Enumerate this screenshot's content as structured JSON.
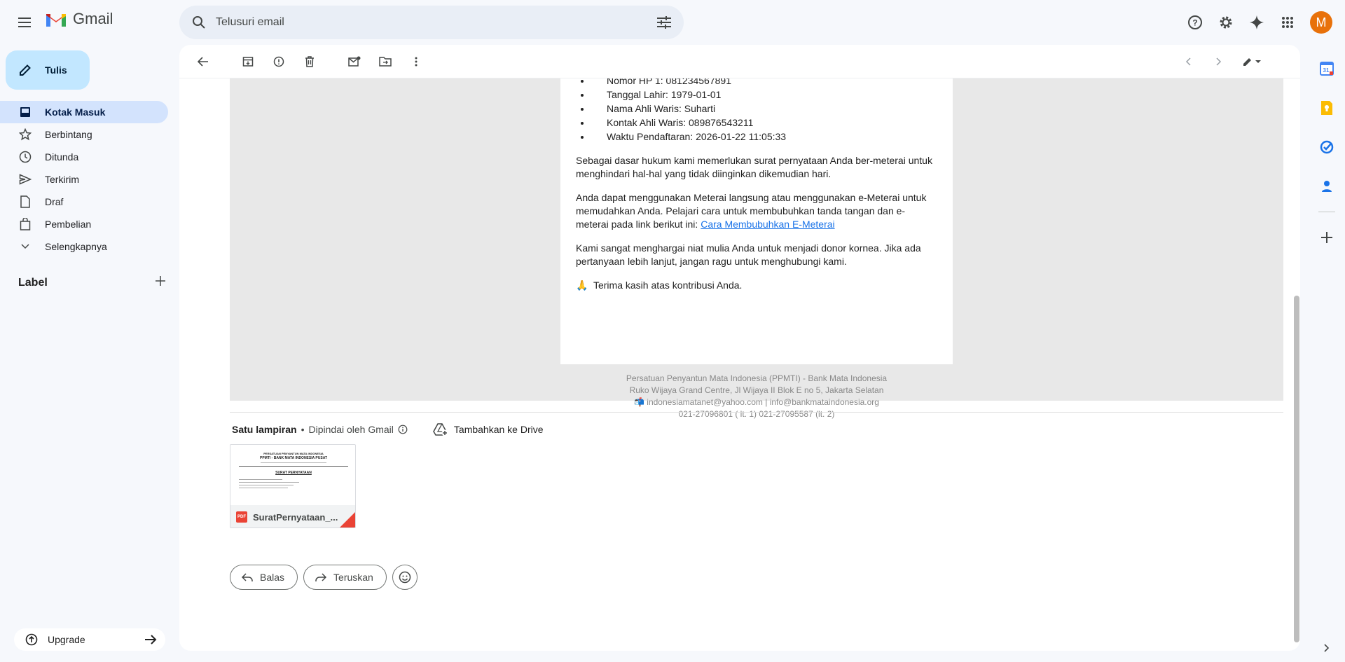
{
  "app": {
    "name": "Gmail"
  },
  "search": {
    "placeholder": "Telusuri email"
  },
  "avatar": {
    "initial": "M",
    "color": "#e8710a"
  },
  "compose": {
    "label": "Tulis"
  },
  "nav": {
    "items": [
      {
        "label": "Kotak Masuk",
        "icon": "inbox-icon",
        "active": true
      },
      {
        "label": "Berbintang",
        "icon": "star-icon"
      },
      {
        "label": "Ditunda",
        "icon": "clock-icon"
      },
      {
        "label": "Terkirim",
        "icon": "send-icon"
      },
      {
        "label": "Draf",
        "icon": "draft-icon"
      },
      {
        "label": "Pembelian",
        "icon": "shopping-bag-icon"
      },
      {
        "label": "Selengkapnya",
        "icon": "chevron-down-icon"
      }
    ],
    "label_title": "Label",
    "upgrade": "Upgrade"
  },
  "email": {
    "details": [
      "Nomor HP 1: 081234567891",
      "Tanggal Lahir: 1979-01-01",
      "Nama Ahli Waris: Suharti",
      "Kontak Ahli Waris: 089876543211",
      "Waktu Pendaftaran: 2026-01-22 11:05:33"
    ],
    "para1": "Sebagai dasar hukum kami memerlukan surat pernyataan Anda ber-meterai untuk menghindari hal-hal yang tidak diinginkan dikemudian hari.",
    "para2_text": "Anda dapat menggunakan Meterai langsung atau menggunakan e-Meterai untuk memudahkan Anda. Pelajari cara untuk membubuhkan tanda tangan dan e-meterai pada link berikut ini: ",
    "para2_link": "Cara Membubuhkan E-Meterai",
    "para3": "Kami sangat menghargai niat mulia Anda untuk menjadi donor kornea. Jika ada pertanyaan lebih lanjut, jangan ragu untuk menghubungi kami.",
    "thanks_emoji": "🙏",
    "thanks": "Terima kasih atas kontribusi Anda.",
    "footer": {
      "org": "Persatuan Penyantun Mata Indonesia (PPMTI) - Bank Mata Indonesia",
      "address": "Ruko Wijaya Grand Centre, Jl Wijaya II Blok E no 5, Jakarta Selatan",
      "mail_emoji": "📬",
      "emails": "indonesiamatanet@yahoo.com | info@bankmataindonesia.org",
      "phones": "021-27096801 ( lt. 1) 021-27095587 (lt. 2)"
    }
  },
  "attachments": {
    "title": "Satu lampiran",
    "scanned": "Dipindai oleh Gmail",
    "drive": "Tambahkan ke Drive",
    "file": {
      "name": "SuratPernyataan_...",
      "type": "PDF",
      "preview_org": "PERSATUAN PENYANTUN MATA INDONESIA",
      "preview_title": "PPMTI - BANK MATA INDONESIA PUSAT",
      "preview_doc": "SURAT PERNYATAAN"
    }
  },
  "actions": {
    "reply": "Balas",
    "forward": "Teruskan"
  }
}
